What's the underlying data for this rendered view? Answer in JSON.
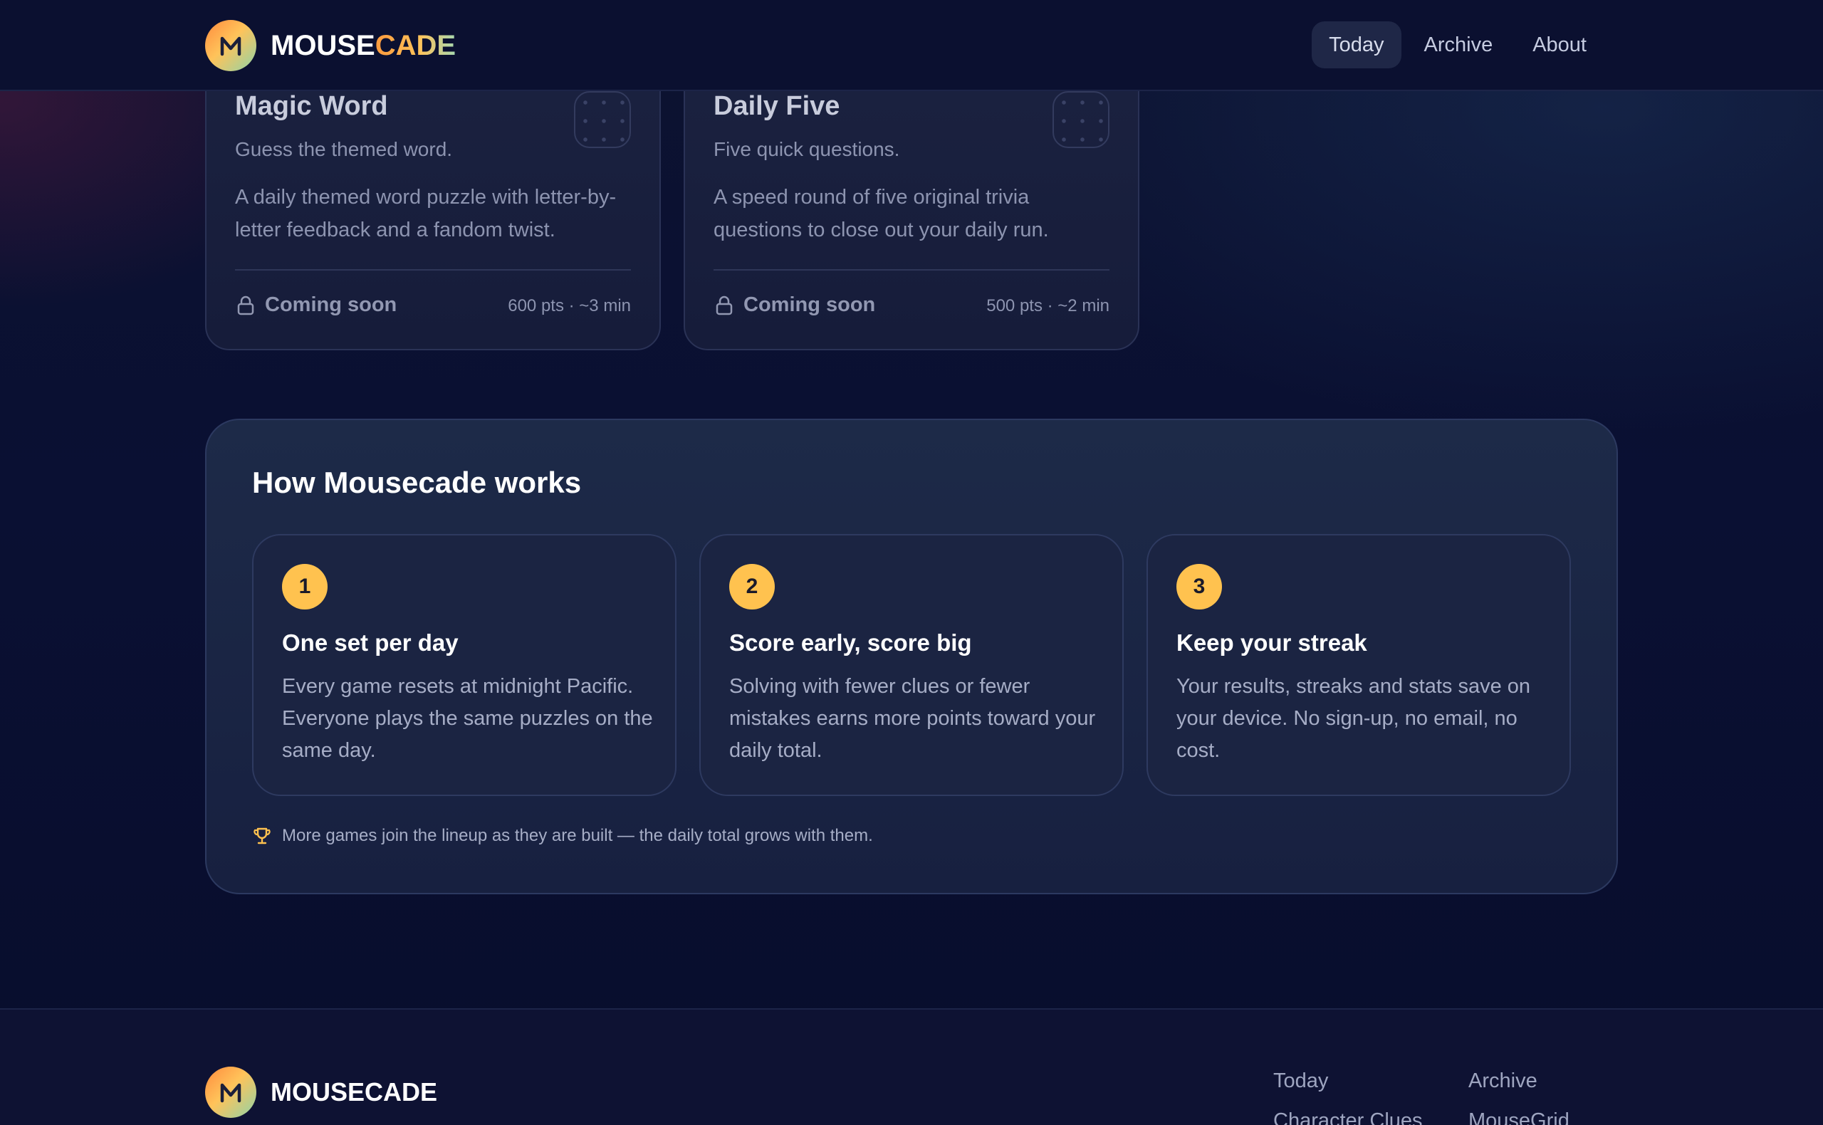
{
  "header": {
    "logo_part1": "MOUSE",
    "logo_part2": "CADE",
    "nav": [
      {
        "label": "Today",
        "active": true
      },
      {
        "label": "Archive",
        "active": false
      },
      {
        "label": "About",
        "active": false
      }
    ]
  },
  "games": [
    {
      "title": "Magic Word",
      "subtitle": "Guess the themed word.",
      "description": "A daily themed word puzzle with letter-by-letter feedback and a fandom twist.",
      "status": "Coming soon",
      "meta": "600 pts · ~3 min",
      "icon": "lock-icon"
    },
    {
      "title": "Daily Five",
      "subtitle": "Five quick questions.",
      "description": "A speed round of five original trivia questions to close out your daily run.",
      "status": "Coming soon",
      "meta": "500 pts · ~2 min",
      "icon": "lock-icon"
    }
  ],
  "how": {
    "title": "How Mousecade works",
    "steps": [
      {
        "number": "1",
        "title": "One set per day",
        "text": "Every game resets at midnight Pacific. Everyone plays the same puzzles on the same day."
      },
      {
        "number": "2",
        "title": "Score early, score big",
        "text": "Solving with fewer clues or fewer mistakes earns more points toward your daily total."
      },
      {
        "number": "3",
        "title": "Keep your streak",
        "text": "Your results, streaks and stats save on your device. No sign-up, no email, no cost."
      }
    ],
    "note": "More games join the lineup as they are built — the daily total grows with them.",
    "note_icon": "trophy-icon"
  },
  "footer": {
    "logo_text": "MOUSECADE",
    "col1": [
      "Today",
      "Character Clues"
    ],
    "col2": [
      "Archive",
      "MouseGrid"
    ]
  },
  "colors": {
    "accent": "#ffc24f",
    "background": "#0a0f2e",
    "card": "#1b2240"
  }
}
